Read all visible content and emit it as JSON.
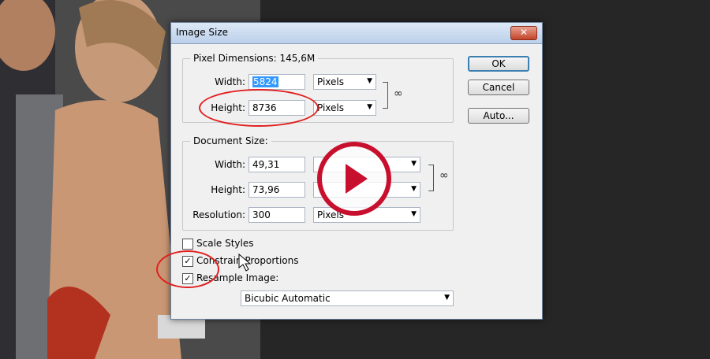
{
  "dialog": {
    "title": "Image Size",
    "close": "✕"
  },
  "pixel_dimensions": {
    "legend": "Pixel Dimensions:",
    "size": "145,6M",
    "width_label": "Width:",
    "width_value": "5824",
    "width_unit": "Pixels",
    "height_label": "Height:",
    "height_value": "8736",
    "height_unit": "Pixels"
  },
  "document_size": {
    "legend": "Document Size:",
    "width_label": "Width:",
    "width_value": "49,31",
    "width_unit": "",
    "height_label": "Height:",
    "height_value": "73,96",
    "height_unit": "",
    "resolution_label": "Resolution:",
    "resolution_value": "300",
    "resolution_unit": "Pixels"
  },
  "buttons": {
    "ok": "OK",
    "cancel": "Cancel",
    "auto": "Auto..."
  },
  "options": {
    "scale_styles": {
      "label": "Scale Styles",
      "checked": false
    },
    "constrain": {
      "label": "Constrain Proportions",
      "checked": true
    },
    "resample": {
      "label": "Resample Image:",
      "checked": true
    },
    "resample_method": "Bicubic Automatic"
  },
  "colors": {
    "accent_ring": "#e02020",
    "play": "#c8102e"
  },
  "icons": {
    "link": "chain-link-icon",
    "dropdown": "chevron-down-icon",
    "play": "play-icon",
    "cursor": "mouse-pointer-icon"
  }
}
